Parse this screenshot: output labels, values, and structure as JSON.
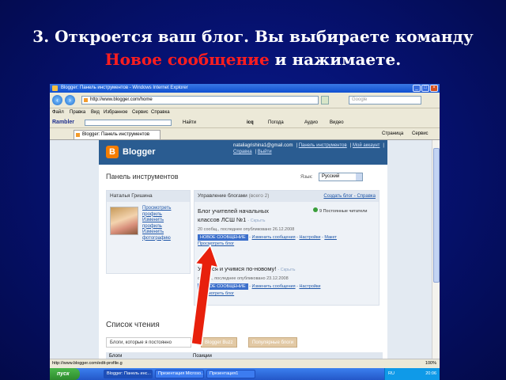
{
  "slide": {
    "title_part1": "3. Откроется ваш блог. Вы выбираете команду",
    "title_highlight": "Новое сообщение",
    "title_part2": " и нажимаете."
  },
  "colors": {
    "slide_bg": "#061273",
    "title_text": "#ffffff",
    "highlight": "#ff1e1e",
    "arrow": "#e8200c",
    "blogger_bar": "#2a5c91",
    "new_post_button": "#3b6fcb"
  },
  "window": {
    "title": "Blogger: Панель инструментов - Windows Internet Explorer",
    "address": "http://www.blogger.com/home",
    "search_placeholder": "Google"
  },
  "browser_links": [
    "Файл",
    "Правка",
    "Вид",
    "Избранное",
    "Сервис",
    "Справка"
  ],
  "toolbar": {
    "rambler": "Rambler",
    "find": "Найти",
    "icq": "icq",
    "weather": "Погода",
    "audio": "Аудио",
    "video": "Видео"
  },
  "tab": {
    "label": "Blogger: Панель инструментов",
    "page_menu": "Страница",
    "tools_menu": "Сервис"
  },
  "blogger": {
    "logo": "Blogger",
    "logo_letter": "B",
    "user_email": "nataliagrishina1@gmail.com",
    "top_links": [
      "Панель инструментов",
      "Мой аккаунт",
      "Справка",
      "Выйти"
    ],
    "page_title": "Панель инструментов",
    "language_label": "Язык:",
    "language_value": "Русский",
    "user_name": "Наталья Гришина",
    "profile_links": [
      "Просмотреть",
      "профиль",
      "Изменить",
      "профиль",
      "Изменить",
      "фотографию"
    ],
    "manage_title": "Управление блогами",
    "manage_count": "(всего 2)",
    "manage_links": "Создать блог - Справка",
    "blog1": {
      "title_line1": "Блог учителей начальных",
      "title_line2": "классов ЛСШ №1",
      "hidden_label": "- Скрыть",
      "followers": "9 Постоянные читатели",
      "meta": "20 сообщ., последнее опубликовано 26.12.2008",
      "new_post": "НОВОЕ СООБЩЕНИЕ",
      "edit_posts": "Изменить сообщения",
      "settings": "Настройки",
      "layout": "Макет",
      "view_blog": "Просмотреть блог"
    },
    "blog2": {
      "title": "Учимся и учимся по-новому!",
      "hidden_label": "- Скрыть",
      "meta": "сообщ., последнее опубликовано 23.12.2008",
      "new_post": "НОВОЕ СООБЩЕНИЕ",
      "edit_posts": "Изменить сообщения",
      "settings": "Настройки",
      "view_blog": "Просмотреть блог"
    },
    "reading_list_title": "Список чтения",
    "reading_tabs": [
      "Блоги, которые я постоянно",
      "Blogger Buzz",
      "Популярные блоги"
    ],
    "reading_headers": [
      "Блоги",
      "Позиции"
    ]
  },
  "status": {
    "url": "http://www.blogger.com/edit-profile.g",
    "zoom": "100%"
  },
  "taskbar": {
    "start": "пуск",
    "tasks": [
      "Blogger: Панель инс...",
      "Презентация Microso...",
      "Презентация1"
    ],
    "lang": "RU",
    "clock": "20:06"
  }
}
